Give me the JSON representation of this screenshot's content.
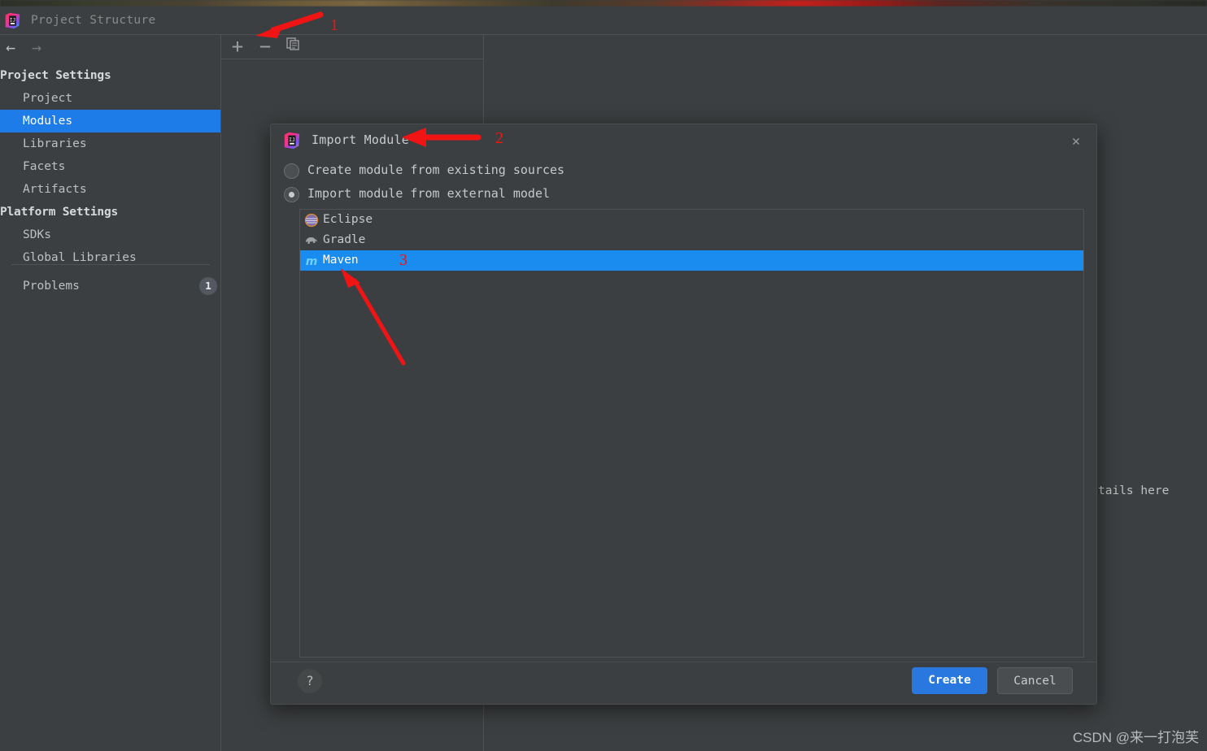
{
  "window": {
    "title": "Project Structure",
    "logo_icon": "intellij-idea-logo"
  },
  "nav": {
    "back_icon": "arrow-left-icon",
    "forward_icon": "arrow-right-icon",
    "groups": [
      {
        "label": "Project Settings",
        "items": [
          {
            "label": "Project",
            "selected": false
          },
          {
            "label": "Modules",
            "selected": true
          },
          {
            "label": "Libraries",
            "selected": false
          },
          {
            "label": "Facets",
            "selected": false
          },
          {
            "label": "Artifacts",
            "selected": false
          }
        ]
      },
      {
        "label": "Platform Settings",
        "items": [
          {
            "label": "SDKs",
            "selected": false
          },
          {
            "label": "Global Libraries",
            "selected": false
          }
        ]
      }
    ],
    "problems": {
      "label": "Problems",
      "count": "1"
    }
  },
  "modules_toolbar": {
    "add_label": "+",
    "remove_label": "−",
    "copy_icon": "copy-icon"
  },
  "detail": {
    "text": "tails here"
  },
  "dialog": {
    "title": "Import Module",
    "logo_icon": "intellij-idea-logo",
    "close_icon": "close-icon",
    "options": [
      {
        "label": "Create module from existing sources",
        "selected": false
      },
      {
        "label": "Import module from external model",
        "selected": true
      }
    ],
    "models": [
      {
        "label": "Eclipse",
        "icon": "eclipse-icon",
        "selected": false
      },
      {
        "label": "Gradle",
        "icon": "gradle-elephant-icon",
        "selected": false
      },
      {
        "label": "Maven",
        "icon": "maven-icon",
        "selected": true
      }
    ],
    "help_label": "?",
    "create_label": "Create",
    "cancel_label": "Cancel"
  },
  "annotations": [
    {
      "number": "1"
    },
    {
      "number": "2"
    },
    {
      "number": "3"
    }
  ],
  "watermark": {
    "text": "CSDN @来一打泡芙"
  },
  "colors": {
    "accent_blue": "#1a8cf0",
    "selection_blue": "#1e7ce8",
    "button_blue": "#2878e0",
    "annotation_red": "#f01414",
    "background": "#3c3f41"
  }
}
